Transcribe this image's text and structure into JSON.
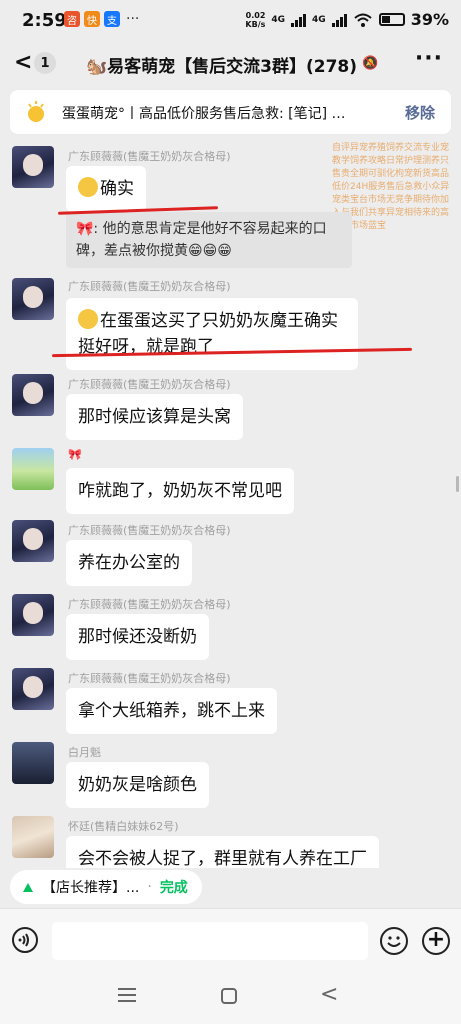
{
  "status": {
    "time": "2:59",
    "battery": "39%",
    "net_speed": "0.02",
    "net_unit": "KB/s",
    "sig1": "4G",
    "sig2": "4G",
    "dots": "···",
    "app1": "咨",
    "app2": "快",
    "app3": "支"
  },
  "header": {
    "back": "<",
    "unread": "1",
    "title": "🐿️易客萌宠【售后交流3群】(278)",
    "more": "···",
    "mute": "🔕"
  },
  "notice": {
    "text": "蛋蛋萌宠°丨高品低价服务售后急救: [笔记] 易客…",
    "action": "移除"
  },
  "watermark": "自评异宠养殖饲养交流专业宠教学饲养攻略日常护理测养只售贵全期可驯化枸宠新货高品低价24H服务售后急救小众异宠类宝台市场无竞争期待你加入与我们共享异宠相待来的高利润市场蓝宝",
  "messages": [
    {
      "nick": "广东顾薇薇(售魔王奶奶灰合格母)",
      "text": "确实",
      "quote": "🎀: 他的意思肯定是他好不容易起来的口碑，差点被你搅黄😁😁😁"
    },
    {
      "nick": "广东顾薇薇(售魔王奶奶灰合格母)",
      "text": "在蛋蛋这买了只奶奶灰魔王确实挺好呀，就是跑了"
    },
    {
      "nick": "广东顾薇薇(售魔王奶奶灰合格母)",
      "text": "那时候应该算是头窝"
    },
    {
      "nick": "🎀",
      "text": "咋就跑了，奶奶灰不常见吧"
    },
    {
      "nick": "广东顾薇薇(售魔王奶奶灰合格母)",
      "text": "养在办公室的"
    },
    {
      "nick": "广东顾薇薇(售魔王奶奶灰合格母)",
      "text": "那时候还没断奶"
    },
    {
      "nick": "广东顾薇薇(售魔王奶奶灰合格母)",
      "text": "拿个大纸箱养，跳不上来"
    },
    {
      "nick": "白月魁",
      "text": "奶奶灰是啥颜色"
    },
    {
      "nick": "怀廷(售精白妹妹62号)",
      "text": "会不会被人捉了，群里就有人养在工厂"
    }
  ],
  "suggestion": {
    "label": "【店长推荐】...",
    "sep": "·",
    "action": "完成"
  },
  "colors": {
    "accent_green": "#07c160",
    "link_blue": "#576b95",
    "annotation_red": "#d22222"
  }
}
